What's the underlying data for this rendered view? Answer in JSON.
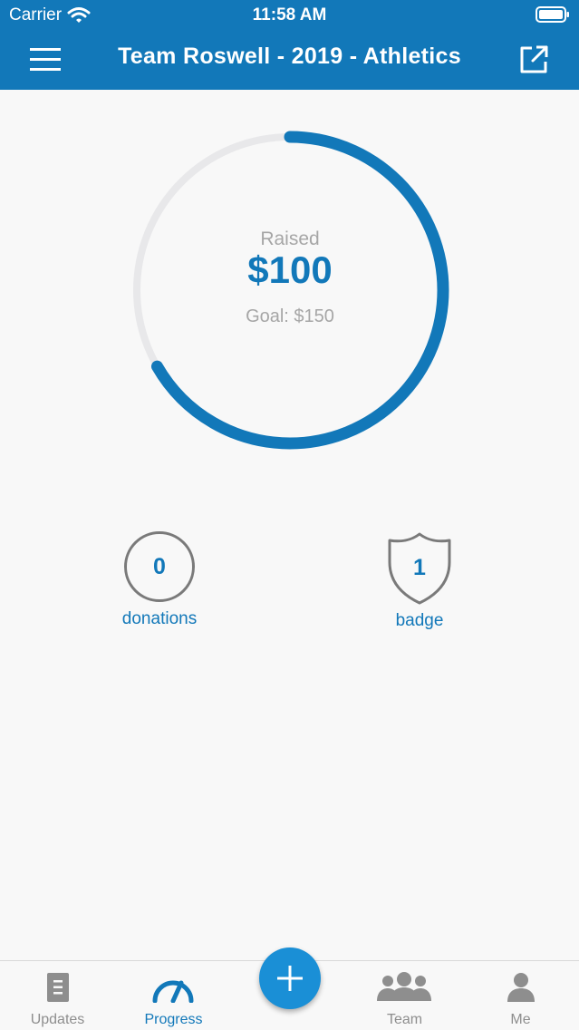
{
  "status": {
    "carrier": "Carrier",
    "time": "11:58 AM"
  },
  "header": {
    "title": "Team Roswell - 2019 - Athletics"
  },
  "progress": {
    "raised_label": "Raised",
    "raised_amount": "$100",
    "goal_label": "Goal: $150",
    "fraction": 0.6667
  },
  "stats": {
    "donations": {
      "value": "0",
      "label": "donations"
    },
    "badge": {
      "value": "1",
      "label": "badge"
    }
  },
  "tabs": [
    {
      "label": "Updates",
      "icon": "document-icon",
      "active": false
    },
    {
      "label": "Progress",
      "icon": "speedometer-icon",
      "active": true
    },
    {
      "label": "Team",
      "icon": "group-icon",
      "active": false
    },
    {
      "label": "Me",
      "icon": "person-icon",
      "active": false
    }
  ],
  "fab": {
    "icon": "plus-icon"
  },
  "colors": {
    "brand": "#1278b9",
    "ring_track": "#e8e8ea",
    "muted": "#8e8e8e",
    "fab": "#1a8fd6"
  }
}
